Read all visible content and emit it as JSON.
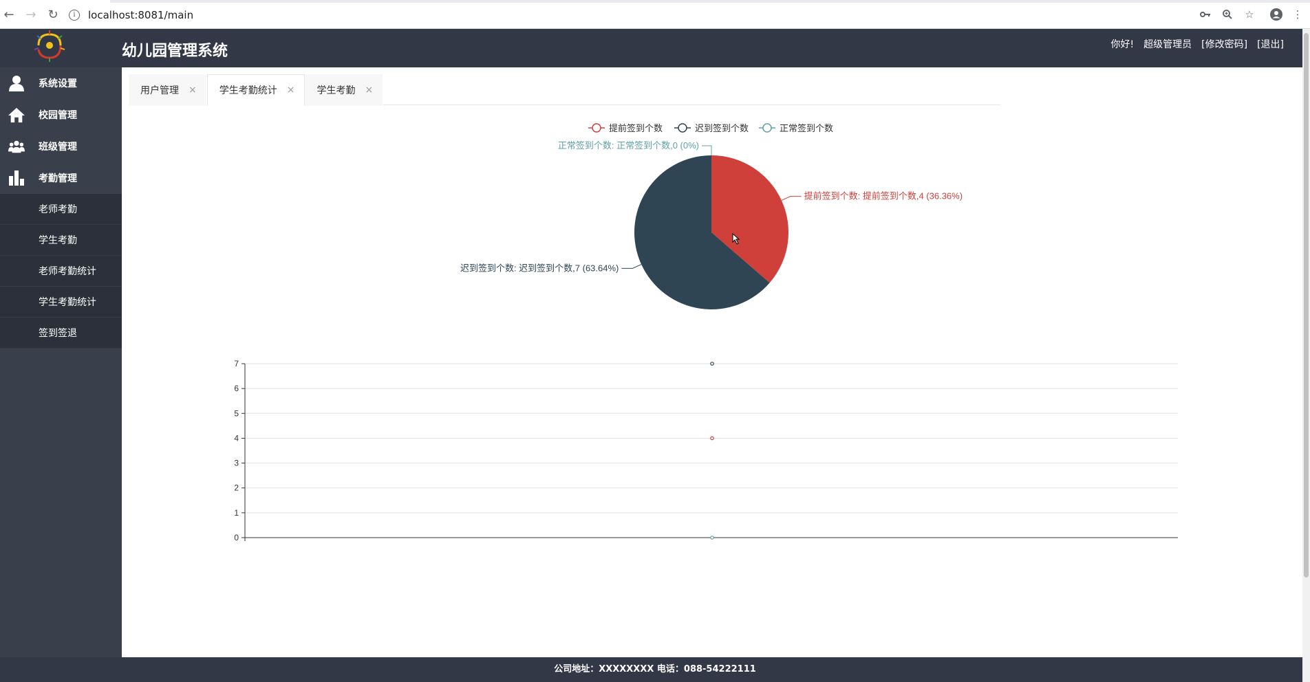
{
  "browser": {
    "url": "localhost:8081/main"
  },
  "header": {
    "title": "幼儿园管理系统",
    "greeting": "你好!",
    "user": "超级管理员",
    "change_password": "[修改密码]",
    "logout": "[退出]"
  },
  "sidebar": {
    "groups": [
      {
        "label": "系统设置",
        "icon": "user-icon"
      },
      {
        "label": "校园管理",
        "icon": "home-icon"
      },
      {
        "label": "班级管理",
        "icon": "group-icon"
      },
      {
        "label": "考勤管理",
        "icon": "bar-chart-icon"
      }
    ],
    "submenu": [
      "老师考勤",
      "学生考勤",
      "老师考勤统计",
      "学生考勤统计",
      "签到签退"
    ]
  },
  "tabs": [
    {
      "label": "用户管理",
      "close": "×"
    },
    {
      "label": "学生考勤统计",
      "close": "×"
    },
    {
      "label": "学生考勤",
      "close": "×"
    }
  ],
  "chart_data": [
    {
      "type": "pie",
      "legend": [
        "提前签到个数",
        "迟到签到个数",
        "正常签到个数"
      ],
      "legend_position": "top-center",
      "slices": [
        {
          "name": "提前签到个数",
          "value": 4,
          "percent": "36.36%",
          "color": "#d0403a",
          "label": "提前签到个数: 提前签到个数,4 (36.36%)"
        },
        {
          "name": "迟到签到个数",
          "value": 7,
          "percent": "63.64%",
          "color": "#2f4554",
          "label": "迟到签到个数: 迟到签到个数,7 (63.64%)"
        },
        {
          "name": "正常签到个数",
          "value": 0,
          "percent": "0%",
          "color": "#61a0a8",
          "label": "正常签到个数: 正常签到个数,0 (0%)"
        }
      ]
    },
    {
      "type": "scatter",
      "ylim": [
        0,
        7
      ],
      "yticks": [
        "0",
        "1",
        "2",
        "3",
        "4",
        "5",
        "6",
        "7"
      ],
      "grid": true,
      "series": [
        {
          "name": "提前签到个数",
          "values": [
            4
          ],
          "color": "#d0403a"
        },
        {
          "name": "迟到签到个数",
          "values": [
            7
          ],
          "color": "#2f4554"
        },
        {
          "name": "正常签到个数",
          "values": [
            0
          ],
          "color": "#61a0a8"
        }
      ]
    }
  ],
  "footer": {
    "text": "公司地址：XXXXXXXX 电话：088-54222111"
  }
}
